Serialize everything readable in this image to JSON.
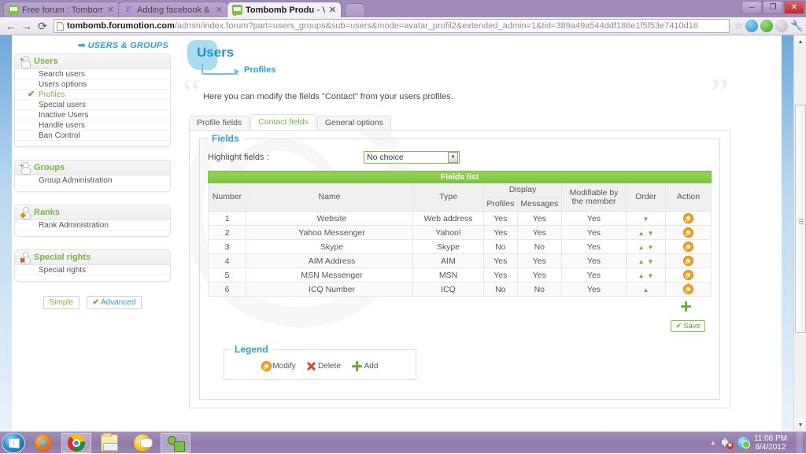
{
  "browser": {
    "tabs": [
      {
        "title": "Free forum : Tombomb Pr",
        "favicon": "forum-icon",
        "active": false
      },
      {
        "title": "Adding facebook & twitter",
        "favicon": "fm-icon",
        "active": false
      },
      {
        "title": "Tombomb Productions",
        "title_dim": "- V",
        "favicon": "forum-icon",
        "active": true
      }
    ],
    "nav": {
      "back": "←",
      "forward": "→",
      "reload": "⟳"
    },
    "url_host": "tombomb.forumotion.com",
    "url_path": "/admin/index.forum?part=users_groups&sub=users&mode=avatar_profil2&extended_admin=1&tid=389a49a544ddf186e1f5f53e7410d16",
    "star": "☆",
    "window_controls": {
      "minimize": "–",
      "maximize": "❐",
      "close": "✕"
    }
  },
  "sidebar": {
    "breadcrumb": "USERS & GROUPS",
    "breadcrumb_arrow": "➡",
    "panels": [
      {
        "title": "Users",
        "icon": "user-icon",
        "items": [
          {
            "label": "Search users",
            "selected": false
          },
          {
            "label": "Users options",
            "selected": false
          },
          {
            "label": "Profiles",
            "selected": true
          },
          {
            "label": "Special users",
            "selected": false
          },
          {
            "label": "Inactive Users",
            "selected": false
          },
          {
            "label": "Handle users",
            "selected": false
          },
          {
            "label": "Ban Control",
            "selected": false
          }
        ]
      },
      {
        "title": "Groups",
        "icon": "groups-icon",
        "items": [
          {
            "label": "Group Administration",
            "selected": false
          }
        ]
      },
      {
        "title": "Ranks",
        "icon": "rank-icon",
        "items": [
          {
            "label": "Rank Administration",
            "selected": false
          }
        ]
      },
      {
        "title": "Special rights",
        "icon": "special-rights-icon",
        "items": [
          {
            "label": "Special rights",
            "selected": false
          }
        ]
      }
    ],
    "mode_simple": "Simple",
    "mode_advanced": "Advanced",
    "check_glyph": "✔"
  },
  "main": {
    "page_title": "Users",
    "page_subtitle": "Profiles",
    "description": "Here you can modify the fields \"Contact\" from your users profiles.",
    "quote_open": "“",
    "quote_close": "”",
    "tabs": [
      {
        "label": "Profile fields",
        "active": false
      },
      {
        "label": "Contact fields",
        "active": true
      },
      {
        "label": "General options",
        "active": false
      }
    ],
    "fieldset_legend": "Fields",
    "highlight_label": "Highlight fields :",
    "highlight_value": "No choice",
    "select_arrow": "▼",
    "table": {
      "title": "Fields list",
      "headers": {
        "number": "Number",
        "name": "Name",
        "type": "Type",
        "display": "Display",
        "display_profiles": "Profiles",
        "display_messages": "Messages",
        "modifiable": "Modifiable by the member",
        "order": "Order",
        "action": "Action"
      },
      "rows": [
        {
          "number": "1",
          "name": "Website",
          "type": "Web address",
          "profiles": "Yes",
          "messages": "Yes",
          "modifiable": "Yes",
          "up": false,
          "down": true
        },
        {
          "number": "2",
          "name": "Yahoo Messenger",
          "type": "Yahoo!",
          "profiles": "Yes",
          "messages": "Yes",
          "modifiable": "Yes",
          "up": true,
          "down": true
        },
        {
          "number": "3",
          "name": "Skype",
          "type": "Skype",
          "profiles": "No",
          "messages": "No",
          "modifiable": "Yes",
          "up": true,
          "down": true
        },
        {
          "number": "4",
          "name": "AIM Address",
          "type": "AIM",
          "profiles": "Yes",
          "messages": "Yes",
          "modifiable": "Yes",
          "up": true,
          "down": true
        },
        {
          "number": "5",
          "name": "MSN Messenger",
          "type": "MSN",
          "profiles": "Yes",
          "messages": "Yes",
          "modifiable": "Yes",
          "up": true,
          "down": true
        },
        {
          "number": "6",
          "name": "ICQ Number",
          "type": "ICQ",
          "profiles": "No",
          "messages": "No",
          "modifiable": "Yes",
          "up": true,
          "down": false
        }
      ],
      "arrow_up": "▲",
      "arrow_down": "▼"
    },
    "save_label": "Save",
    "save_glyph": "✔",
    "legend": {
      "title": "Legend",
      "items": [
        {
          "label": "Modify",
          "icon": "modify-icon"
        },
        {
          "label": "Delete",
          "icon": "delete-icon"
        },
        {
          "label": "Add",
          "icon": "add-icon"
        }
      ]
    }
  },
  "taskbar": {
    "start": "start-orb",
    "items": [
      {
        "name": "firefox-taskbar-icon",
        "pinned": false
      },
      {
        "name": "chrome-taskbar-icon",
        "pinned": true
      },
      {
        "name": "explorer-taskbar-icon",
        "pinned": false
      },
      {
        "name": "messenger-taskbar-icon",
        "pinned": false
      },
      {
        "name": "users-taskbar-icon",
        "pinned": true
      }
    ],
    "tray_caret": "▲",
    "clock_time": "11:08 PM",
    "clock_date": "8/4/2012"
  }
}
